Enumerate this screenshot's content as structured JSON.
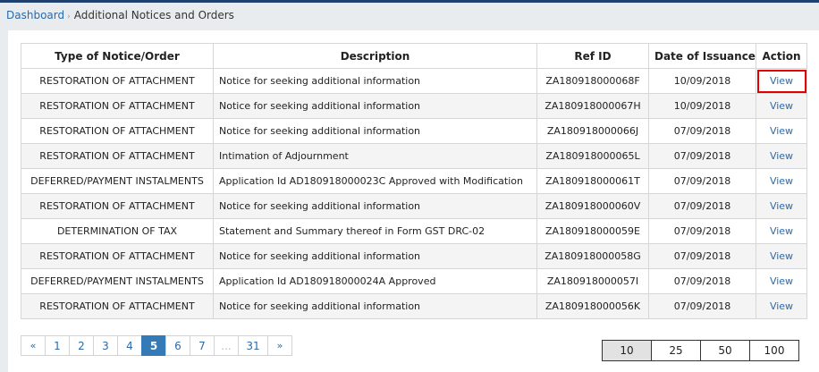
{
  "breadcrumb": {
    "home": "Dashboard",
    "separator": "›",
    "current": "Additional Notices and Orders"
  },
  "table": {
    "headers": {
      "type": "Type of Notice/Order",
      "description": "Description",
      "ref_id": "Ref ID",
      "date": "Date of Issuance",
      "action": "Action"
    },
    "rows": [
      {
        "type": "RESTORATION OF ATTACHMENT",
        "description": "Notice for seeking additional information",
        "ref_id": "ZA180918000068F",
        "date": "10/09/2018",
        "action": "View"
      },
      {
        "type": "RESTORATION OF ATTACHMENT",
        "description": "Notice for seeking additional information",
        "ref_id": "ZA180918000067H",
        "date": "10/09/2018",
        "action": "View"
      },
      {
        "type": "RESTORATION OF ATTACHMENT",
        "description": "Notice for seeking additional information",
        "ref_id": "ZA180918000066J",
        "date": "07/09/2018",
        "action": "View"
      },
      {
        "type": "RESTORATION OF ATTACHMENT",
        "description": "Intimation of Adjournment",
        "ref_id": "ZA180918000065L",
        "date": "07/09/2018",
        "action": "View"
      },
      {
        "type": "DEFERRED/PAYMENT INSTALMENTS",
        "description": "Application Id AD180918000023C Approved with Modification",
        "ref_id": "ZA180918000061T",
        "date": "07/09/2018",
        "action": "View"
      },
      {
        "type": "RESTORATION OF ATTACHMENT",
        "description": "Notice for seeking additional information",
        "ref_id": "ZA180918000060V",
        "date": "07/09/2018",
        "action": "View"
      },
      {
        "type": "DETERMINATION OF TAX",
        "description": "Statement and Summary thereof in Form GST DRC-02",
        "ref_id": "ZA180918000059E",
        "date": "07/09/2018",
        "action": "View"
      },
      {
        "type": "RESTORATION OF ATTACHMENT",
        "description": "Notice for seeking additional information",
        "ref_id": "ZA180918000058G",
        "date": "07/09/2018",
        "action": "View"
      },
      {
        "type": "DEFERRED/PAYMENT INSTALMENTS",
        "description": "Application Id AD180918000024A Approved",
        "ref_id": "ZA180918000057I",
        "date": "07/09/2018",
        "action": "View"
      },
      {
        "type": "RESTORATION OF ATTACHMENT",
        "description": "Notice for seeking additional information",
        "ref_id": "ZA180918000056K",
        "date": "07/09/2018",
        "action": "View"
      }
    ]
  },
  "pagination": {
    "prev": "«",
    "pages": [
      "1",
      "2",
      "3",
      "4",
      "5",
      "6",
      "7",
      "...",
      "31"
    ],
    "active_page": "5",
    "next": "»"
  },
  "page_size": {
    "options": [
      "10",
      "25",
      "50",
      "100"
    ],
    "selected": "10"
  },
  "colors": {
    "link": "#2a6aa9",
    "active_page": "#337ab7",
    "highlight_border": "#e00000"
  }
}
